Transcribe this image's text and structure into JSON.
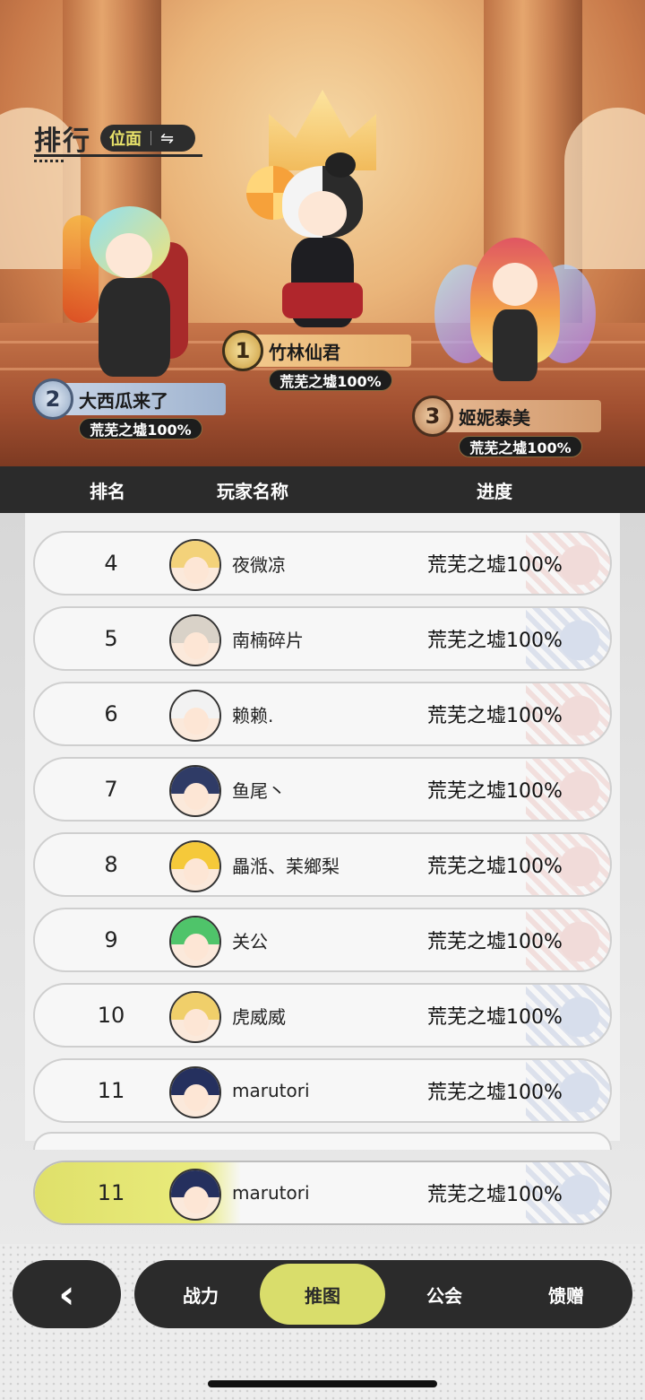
{
  "header": {
    "title": "排行",
    "filter_label": "位面",
    "swap_icon": "⇋"
  },
  "podium": [
    {
      "rank": "1",
      "name": "竹林仙君",
      "progress": "荒芜之墟100%"
    },
    {
      "rank": "2",
      "name": "大西瓜来了",
      "progress": "荒芜之墟100%"
    },
    {
      "rank": "3",
      "name": "姬妮泰美",
      "progress": "荒芜之墟100%"
    }
  ],
  "columns": {
    "rank": "排名",
    "player": "玩家名称",
    "progress": "进度"
  },
  "rows": [
    {
      "rank": "4",
      "player": "夜微凉",
      "progress": "荒芜之墟100%"
    },
    {
      "rank": "5",
      "player": "南楠碎片",
      "progress": "荒芜之墟100%"
    },
    {
      "rank": "6",
      "player": "赖赖.",
      "progress": "荒芜之墟100%"
    },
    {
      "rank": "7",
      "player": "鱼尾丶",
      "progress": "荒芜之墟100%"
    },
    {
      "rank": "8",
      "player": "畾湉、苿鄉梨",
      "progress": "荒芜之墟100%"
    },
    {
      "rank": "9",
      "player": "关公",
      "progress": "荒芜之墟100%"
    },
    {
      "rank": "10",
      "player": "虎威威",
      "progress": "荒芜之墟100%"
    },
    {
      "rank": "11",
      "player": "marutori",
      "progress": "荒芜之墟100%"
    }
  ],
  "me": {
    "rank": "11",
    "player": "marutori",
    "progress": "荒芜之墟100%"
  },
  "nav": {
    "back_icon": "‹",
    "tabs": [
      "战力",
      "推图",
      "公会",
      "馈赠"
    ],
    "active_tab": "推图"
  },
  "colors": {
    "accent": "#d9dd6b",
    "dark": "#2b2b2b"
  }
}
